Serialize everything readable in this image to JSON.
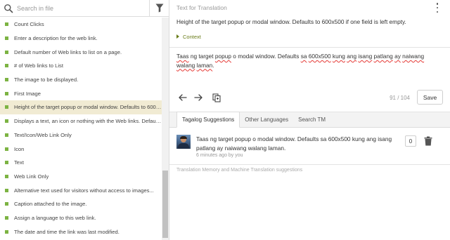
{
  "search": {
    "placeholder": "Search in file"
  },
  "strings": [
    {
      "label": "Count Clicks"
    },
    {
      "label": "Enter a description for the web link."
    },
    {
      "label": "Default number of Web links to list on a page."
    },
    {
      "label": "# of Web links to List"
    },
    {
      "label": "The image to be displayed."
    },
    {
      "label": "First Image"
    },
    {
      "label": "Height of the target popup or modal window. Defaults to 600x500 if one field is left empty.",
      "active": true
    },
    {
      "label": "Displays a text, an icon or nothing with the Web links. Default is Icon."
    },
    {
      "label": "Text/Icon/Web Link Only"
    },
    {
      "label": "Icon"
    },
    {
      "label": "Text"
    },
    {
      "label": "Web Link Only"
    },
    {
      "label": "Alternative text used for visitors without access to images..."
    },
    {
      "label": "Caption attached to the image."
    },
    {
      "label": "Assign a language to this web link."
    },
    {
      "label": "The date and time the link was last modified."
    }
  ],
  "source": {
    "header": "Text for Translation",
    "text": "Height of the target popup or modal window. Defaults to 600x500 if one field is left empty.",
    "context_label": "Context"
  },
  "translation": {
    "words": [
      {
        "t": "Taas",
        "sq": true
      },
      {
        "t": " ng target "
      },
      {
        "t": "popup",
        "sq": true
      },
      {
        "t": " o modal window. Defaults "
      },
      {
        "t": "sa",
        "sq": true
      },
      {
        "t": " "
      },
      {
        "t": "600x500",
        "sq": true
      },
      {
        "t": " "
      },
      {
        "t": "kung",
        "sq": true
      },
      {
        "t": " "
      },
      {
        "t": "ang",
        "sq": true
      },
      {
        "t": " "
      },
      {
        "t": "isang",
        "sq": true
      },
      {
        "t": " "
      },
      {
        "t": "patlang",
        "sq": true
      },
      {
        "t": " "
      },
      {
        "t": "ay",
        "sq": true
      },
      {
        "t": " "
      },
      {
        "t": "naiwang",
        "sq": true
      },
      {
        "t": " "
      },
      {
        "t": "walang",
        "sq": true
      },
      {
        "t": " "
      },
      {
        "t": "laman",
        "sq": true
      },
      {
        "t": "."
      }
    ]
  },
  "toolbar": {
    "counter": "91 / 104",
    "save_label": "Save"
  },
  "tabs": [
    {
      "label": "Tagalog Suggestions",
      "active": true
    },
    {
      "label": "Other Languages"
    },
    {
      "label": "Search TM"
    }
  ],
  "suggestion": {
    "text": "Taas ng target popup o modal window. Defaults sa 600x500 kung ang isang patlang ay naiwang walang laman.",
    "meta": "6 minutes ago by you",
    "votes": "0"
  },
  "tm_note": "Translation Memory and Machine Translation suggestions",
  "colors": {
    "accent_green": "#7cb342",
    "active_row": "#f1ebd3",
    "context": "#6a7d1a",
    "spell_error": "#e53935"
  },
  "icons": [
    "search-icon",
    "filter-icon",
    "kebab-menu-icon",
    "arrow-left-icon",
    "arrow-right-icon",
    "copy-source-icon",
    "trash-icon"
  ]
}
